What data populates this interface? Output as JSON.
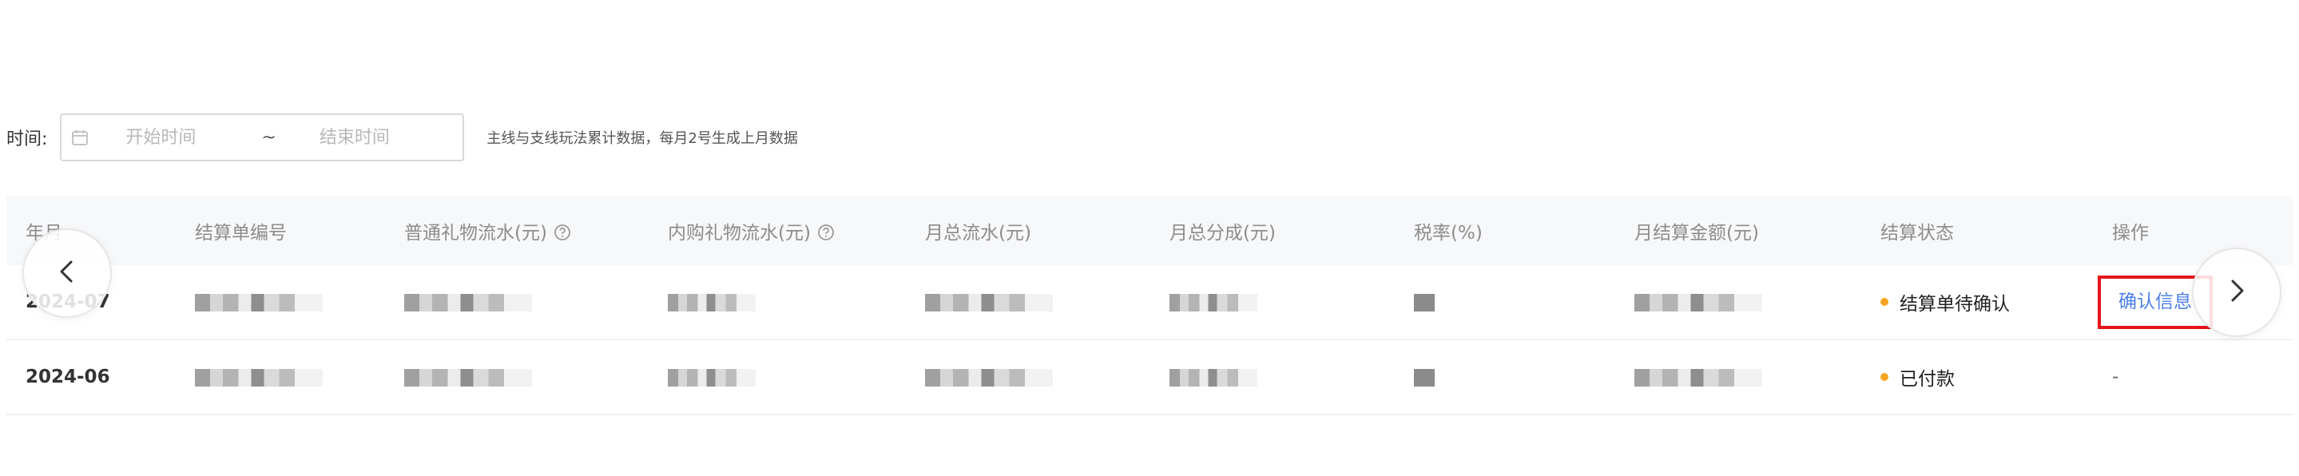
{
  "filter": {
    "label": "时间:",
    "start_placeholder": "开始时间",
    "separator": "~",
    "end_placeholder": "结束时间",
    "note": "主线与支线玩法累计数据，每月2号生成上月数据"
  },
  "table": {
    "columns": [
      "年月",
      "结算单编号",
      "普通礼物流水(元)",
      "内购礼物流水(元)",
      "月总流水(元)",
      "月总分成(元)",
      "税率(%)",
      "月结算金额(元)",
      "结算状态",
      "操作"
    ],
    "rows": [
      {
        "period": "2024-07",
        "status": "结算单待确认",
        "action": "确认信息"
      },
      {
        "period": "2024-06",
        "status": "已付款",
        "action": "-"
      }
    ]
  },
  "icons": {
    "calendar": "calendar-icon",
    "help": "question-circle-icon",
    "prev": "chevron-left-icon",
    "next": "chevron-right-icon"
  },
  "colors": {
    "link": "#4d7fe8",
    "highlight_border": "#e5141b",
    "status_dot": "#f5a623",
    "header_bg": "#f7f8fa"
  }
}
